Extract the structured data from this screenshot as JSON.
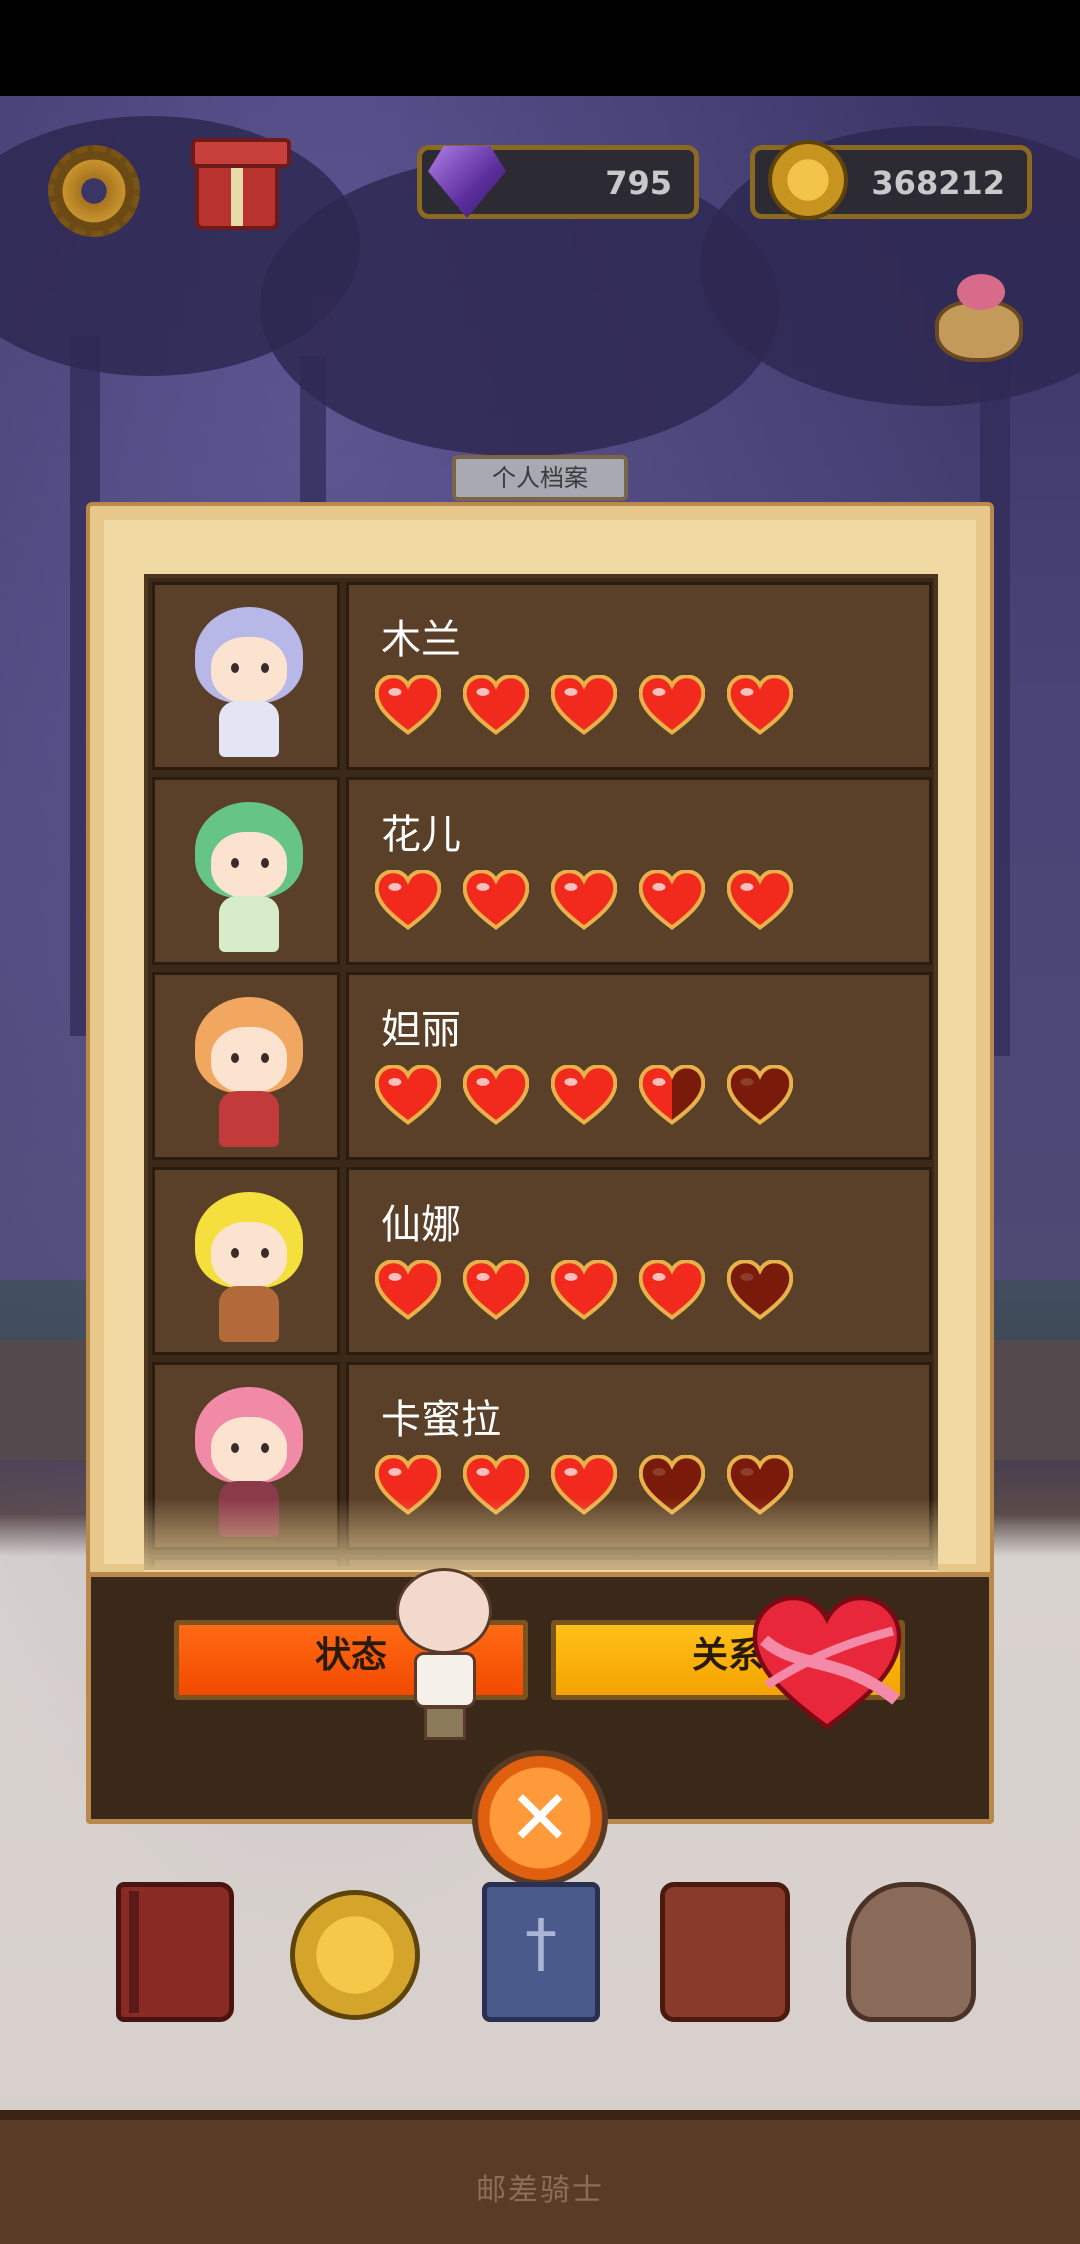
{
  "hud": {
    "gems": "795",
    "coins": "368212"
  },
  "profile": {
    "tab_label": "个人档案",
    "characters": [
      {
        "name": "木兰",
        "hearts": [
          1,
          1,
          1,
          1,
          1
        ]
      },
      {
        "name": "花儿",
        "hearts": [
          1,
          1,
          1,
          1,
          1
        ]
      },
      {
        "name": "妲丽",
        "hearts": [
          1,
          1,
          1,
          0.5,
          0
        ]
      },
      {
        "name": "仙娜",
        "hearts": [
          1,
          1,
          1,
          1,
          0
        ]
      },
      {
        "name": "卡蜜拉",
        "hearts": [
          1,
          1,
          1,
          0,
          0
        ]
      }
    ]
  },
  "controls": {
    "status_label": "状态",
    "relation_label": "关系",
    "close_symbol": "✕"
  },
  "footer": {
    "title": "邮差骑士"
  },
  "colors": {
    "heart_full": "#f22a1e",
    "heart_empty": "#7a1a0a",
    "status_button": "#f24a00",
    "relation_button": "#f5a300"
  },
  "icons": [
    "gear-icon",
    "gift-icon",
    "gem-icon",
    "coin-icon",
    "pot-icon",
    "book-icon",
    "star-coin-icon",
    "card-icon",
    "bag-icon",
    "sack-icon"
  ]
}
